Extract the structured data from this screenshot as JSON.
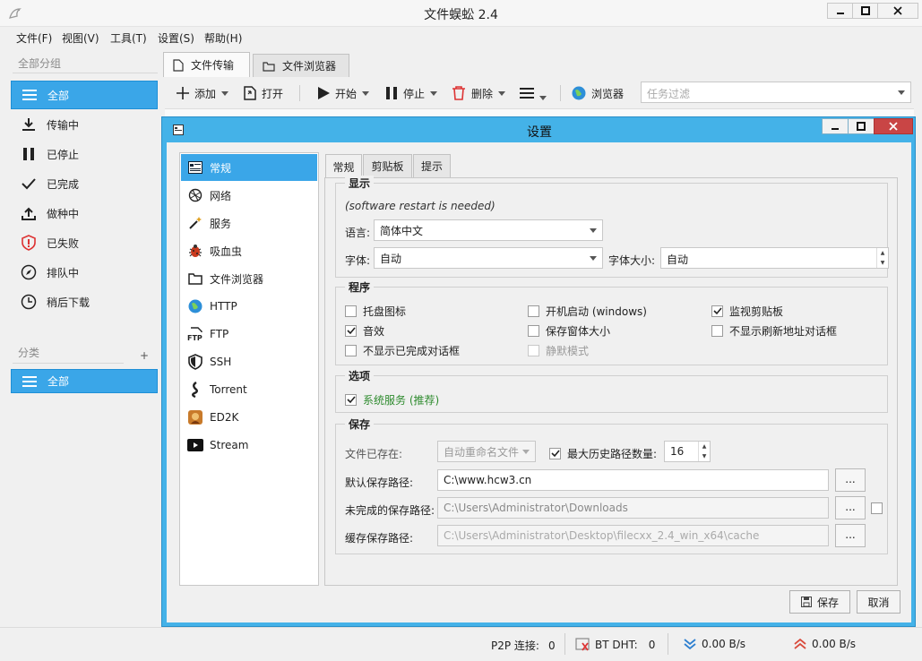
{
  "window": {
    "title": "文件蜈蚣 2.4"
  },
  "menu": [
    "文件(F)",
    "视图(V)",
    "工具(T)",
    "设置(S)",
    "帮助(H)"
  ],
  "sidebar": {
    "group_header": "全部分组",
    "items": [
      {
        "label": "全部",
        "icon": "list-icon"
      },
      {
        "label": "传输中",
        "icon": "download-icon"
      },
      {
        "label": "已停止",
        "icon": "pause-icon"
      },
      {
        "label": "已完成",
        "icon": "check-icon"
      },
      {
        "label": "做种中",
        "icon": "upload-icon"
      },
      {
        "label": "已失败",
        "icon": "error-shield-icon"
      },
      {
        "label": "排队中",
        "icon": "compass-icon"
      },
      {
        "label": "稍后下载",
        "icon": "clock-icon"
      }
    ],
    "category_header": "分类",
    "category_add": "+",
    "categories": [
      {
        "label": "全部",
        "icon": "list-icon"
      }
    ]
  },
  "main_tabs": [
    {
      "label": "文件传输",
      "icon": "file-icon"
    },
    {
      "label": "文件浏览器",
      "icon": "folder-icon"
    }
  ],
  "toolbar": {
    "add": "添加",
    "open": "打开",
    "start": "开始",
    "stop": "停止",
    "delete": "删除",
    "browser": "浏览器",
    "filter_placeholder": "任务过滤"
  },
  "status": {
    "p2p_label": "P2P 连接:",
    "p2p_value": "0",
    "bt_label": "BT DHT:",
    "bt_value": "0",
    "down_speed": "0.00 B/s",
    "up_speed": "0.00 B/s"
  },
  "dialog": {
    "title": "设置",
    "nav": [
      {
        "label": "常规",
        "icon": "general-icon"
      },
      {
        "label": "网络",
        "icon": "network-icon"
      },
      {
        "label": "服务",
        "icon": "wand-icon"
      },
      {
        "label": "吸血虫",
        "icon": "bug-icon"
      },
      {
        "label": "文件浏览器",
        "icon": "folder-icon"
      },
      {
        "label": "HTTP",
        "icon": "globe-icon"
      },
      {
        "label": "FTP",
        "icon": "ftp-icon"
      },
      {
        "label": "SSH",
        "icon": "shield-icon"
      },
      {
        "label": "Torrent",
        "icon": "torrent-icon"
      },
      {
        "label": "ED2K",
        "icon": "ed2k-icon"
      },
      {
        "label": "Stream",
        "icon": "stream-icon"
      }
    ],
    "tabs": [
      "常规",
      "剪贴板",
      "提示"
    ],
    "display": {
      "title": "显示",
      "note": "(software restart is needed)",
      "language_label": "语言:",
      "language_value": "简体中文",
      "font_label": "字体:",
      "font_value": "自动",
      "font_size_label": "字体大小:",
      "font_size_value": "自动"
    },
    "program": {
      "title": "程序",
      "options": [
        {
          "label": "托盘图标",
          "checked": false,
          "enabled": true
        },
        {
          "label": "开机启动 (windows)",
          "checked": false,
          "enabled": true
        },
        {
          "label": "监视剪贴板",
          "checked": true,
          "enabled": true
        },
        {
          "label": "音效",
          "checked": true,
          "enabled": true
        },
        {
          "label": "保存窗体大小",
          "checked": false,
          "enabled": true
        },
        {
          "label": "不显示刷新地址对话框",
          "checked": false,
          "enabled": true
        },
        {
          "label": "不显示已完成对话框",
          "checked": false,
          "enabled": true
        },
        {
          "label": "静默模式",
          "checked": false,
          "enabled": false
        }
      ]
    },
    "options": {
      "title": "选项",
      "system_service": "系统服务 (推荐)",
      "system_service_checked": true
    },
    "save": {
      "title": "保存",
      "file_exists_label": "文件已存在:",
      "file_exists_value": "自动重命名文件",
      "max_history_label": "最大历史路径数量:",
      "max_history_checked": true,
      "max_history_value": "16",
      "default_path_label": "默认保存路径:",
      "default_path_value": "C:\\www.hcw3.cn",
      "incomplete_path_label": "未完成的保存路径:",
      "incomplete_path_value": "C:\\Users\\Administrator\\Downloads",
      "cache_path_label": "缓存保存路径:",
      "cache_path_value": "C:\\Users\\Administrator\\Desktop\\filecxx_2.4_win_x64\\cache",
      "browse": "..."
    },
    "save_button": "保存",
    "cancel_button": "取消"
  }
}
